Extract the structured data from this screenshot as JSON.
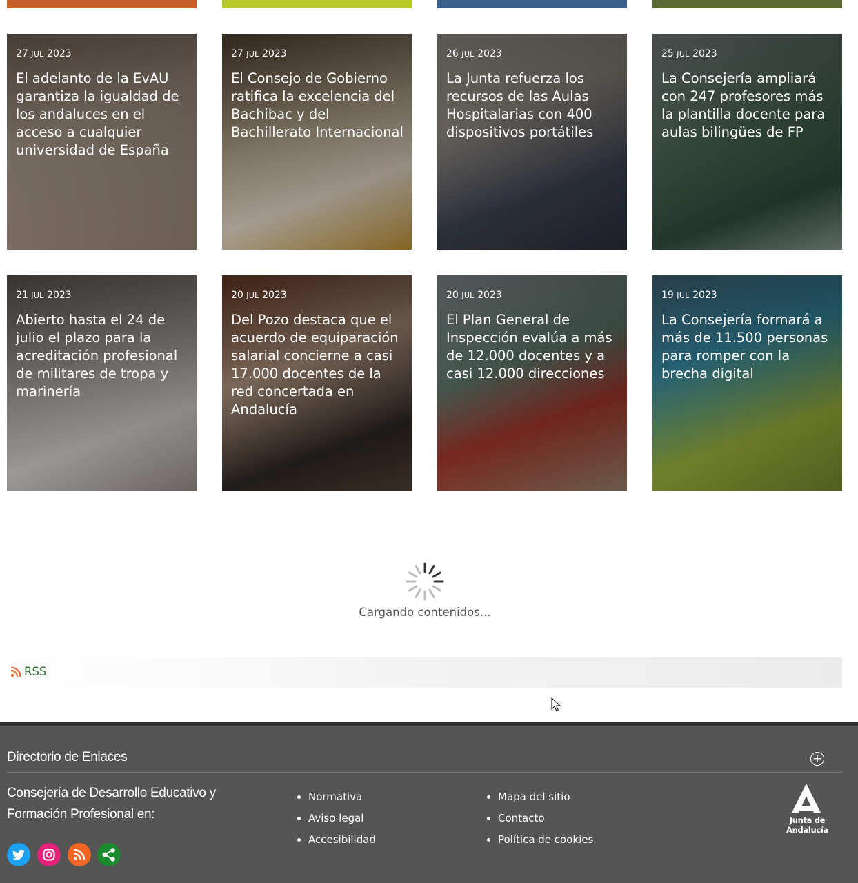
{
  "news_top_row": [
    {
      "bg": "#c75f2a"
    },
    {
      "bg": "#b6c92a"
    },
    {
      "bg": "#3a5f8a"
    },
    {
      "bg": "#5a6a33"
    }
  ],
  "news": [
    {
      "day": "27",
      "month": "jul",
      "year": "2023",
      "title": "El adelanto de la EvAU garantiza la igualdad de los andaluces en el acceso a cualquier universidad de España",
      "bg": "linear-gradient(160deg,#9b8978 0%,#b7a695 40%,#8f7f70 100%)"
    },
    {
      "day": "27",
      "month": "jul",
      "year": "2023",
      "title": "El Consejo de Gobierno ratifica la excelencia del Bachibac y del Bachillerato Internacional",
      "bg": "linear-gradient(160deg,#6e5a44 0%,#c7b79c 45%,#e3d8c6 70%,#b0862f 100%)"
    },
    {
      "day": "26",
      "month": "jul",
      "year": "2023",
      "title": "La Junta refuerza los recursos de las Aulas Hospitalarias con 400 dispositivos portátiles",
      "bg": "linear-gradient(160deg,#c7bfb3 0%,#a59d93 35%,#3b4150 70%,#262a33 100%)"
    },
    {
      "day": "25",
      "month": "jul",
      "year": "2023",
      "title": "La Consejería ampliará con 247 profesores más la plantilla docente para aulas bilingües de FP",
      "bg": "linear-gradient(160deg,#9ea9a7 0%,#4f6f5a 45%,#2c4a39 75%,#7d8e85 100%)"
    },
    {
      "day": "21",
      "month": "jul",
      "year": "2023",
      "title": "Abierto hasta el 24 de julio el plazo para la acreditación profesional de militares de tropa y marinería",
      "bg": "linear-gradient(160deg,#7c7571 0%,#b8b2ad 45%,#d6d1cc 70%,#8e8682 100%)"
    },
    {
      "day": "20",
      "month": "jul",
      "year": "2023",
      "title": "Del Pozo destaca que el acuerdo de equiparación salarial concierne a casi 17.000 docentes de la red concertada en Andalucía",
      "bg": "linear-gradient(160deg,#8a4e32 0%,#c4a58e 40%,#2c2622 75%,#4a3b2f 100%)"
    },
    {
      "day": "20",
      "month": "jul",
      "year": "2023",
      "title": "El Plan General de Inspección evalúa a más de 12.000 docentes y a casi 12.000 direcciones",
      "bg": "linear-gradient(160deg,#b8bfc3 0%,#6b8a7c 40%,#a6372c 65%,#8d7a63 100%)"
    },
    {
      "day": "19",
      "month": "jul",
      "year": "2023",
      "title": "La Consejería formará a más de 11.500 personas para romper con la brecha digital",
      "bg": "linear-gradient(160deg,#5a8aa5 0%,#3ea1bf 35%,#9ab03a 70%,#6a7d2a 100%)"
    }
  ],
  "loading": {
    "text": "Cargando contenidos..."
  },
  "rss": {
    "label": "RSS",
    "icon": "rss-icon"
  },
  "footer": {
    "directory_title": "Directorio de Enlaces",
    "expand_icon": "plus-circle-icon",
    "consejeria_text": "Consejería de Desarrollo Educativo y Formación Profesional en:",
    "links_col1": [
      "Normativa",
      "Aviso legal",
      "Accesibilidad"
    ],
    "links_col2": [
      "Mapa del sitio",
      "Contacto",
      "Política de cookies"
    ],
    "social": [
      {
        "name": "twitter-icon",
        "color": "#1da1f2"
      },
      {
        "name": "instagram-icon",
        "color": "#e4227a"
      },
      {
        "name": "rss-feed-icon",
        "color": "#f26522"
      },
      {
        "name": "share-icon",
        "color": "#1a8c2e"
      }
    ],
    "logo_text": "Junta de Andalucía"
  }
}
